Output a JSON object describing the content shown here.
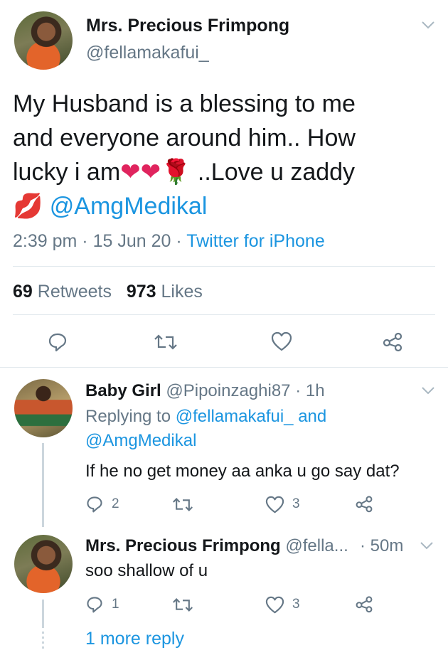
{
  "main_tweet": {
    "display_name": "Mrs. Precious Frimpong",
    "handle": "@fellamakafui_",
    "text_line1": "My Husband is a blessing to me",
    "text_line2": "and everyone around him.. How",
    "text_line3a": "lucky i am",
    "text_line3_emoji": "❤❤🌹",
    "text_line3b": " ..Love u zaddy",
    "text_line4_emoji": "💋",
    "mention": "@AmgMedikal",
    "time": "2:39 pm",
    "dot1": "·",
    "date": "15 Jun 20",
    "dot2": "·",
    "source": "Twitter for iPhone",
    "retweets_count": "69",
    "retweets_label": "Retweets",
    "likes_count": "973",
    "likes_label": "Likes"
  },
  "reply1": {
    "display_name": "Baby Girl",
    "handle": "@Pipoinzaghi87",
    "time": "· 1h",
    "replying_prefix": "Replying to ",
    "replying_user1": "@fellamakafui_",
    "replying_and": " and",
    "replying_user2": "@AmgMedikal",
    "text": "If he no get money aa anka u go say dat?",
    "reply_count": "2",
    "like_count": "3"
  },
  "reply2": {
    "display_name": "Mrs. Precious Frimpong",
    "handle": "@fella...",
    "time": "· 50m",
    "text": "soo shallow of u",
    "reply_count": "1",
    "like_count": "3"
  },
  "more_replies": "1 more reply",
  "icons": [
    "chevron-down-icon",
    "reply-icon",
    "retweet-icon",
    "like-icon",
    "share-icon"
  ],
  "colors": {
    "link": "#1b95e0",
    "secondary": "#657786",
    "heart": "#e0245e"
  }
}
